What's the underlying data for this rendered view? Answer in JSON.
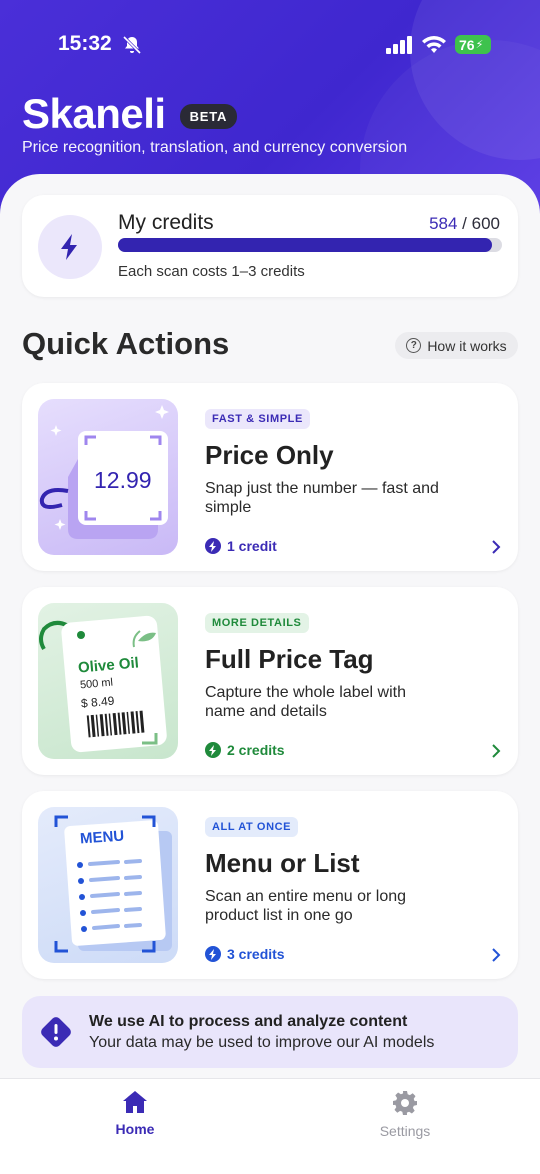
{
  "status_bar": {
    "time": "15:32",
    "battery": "76"
  },
  "header": {
    "app_name": "Skaneli",
    "badge": "BETA",
    "tagline": "Price recognition, translation, and currency conversion"
  },
  "credits": {
    "title": "My credits",
    "used": "584",
    "separator": " / ",
    "total": "600",
    "progress_fraction": 0.973,
    "note": "Each scan costs 1–3 credits"
  },
  "quick_actions": {
    "title": "Quick Actions",
    "how_it_works": "How it works",
    "items": [
      {
        "badge": "FAST & SIMPLE",
        "title": "Price Only",
        "description": "Snap just the number — fast and simple",
        "credits": "1 credit",
        "thumb_price": "12.99",
        "accent": "#3b2bb5",
        "badge_bg": "#ebe7fb"
      },
      {
        "badge": "MORE DETAILS",
        "title": "Full Price Tag",
        "description": "Capture the whole label with name and details",
        "credits": "2 credits",
        "thumb_product": "Olive Oil",
        "thumb_volume": "500 ml",
        "thumb_price": "$ 8.49",
        "accent": "#1f8a3b",
        "badge_bg": "#e3f3e6"
      },
      {
        "badge": "ALL AT ONCE",
        "title": "Menu or List",
        "description": "Scan an entire menu or long product list in one go",
        "credits": "3 credits",
        "thumb_label": "MENU",
        "accent": "#2253d6",
        "badge_bg": "#e3ebfb"
      }
    ]
  },
  "ai_notice": {
    "title": "We use AI to process and analyze content",
    "text": "Your data may be used to improve our AI models"
  },
  "tabs": [
    {
      "label": "Home",
      "active": true,
      "icon": "home-icon"
    },
    {
      "label": "Settings",
      "active": false,
      "icon": "gear-icon"
    }
  ],
  "colors": {
    "brand": "#4a2fd8",
    "progress": "#3324b0",
    "tab_active": "#3b2bb5",
    "tab_inactive": "#9a9aa2"
  }
}
